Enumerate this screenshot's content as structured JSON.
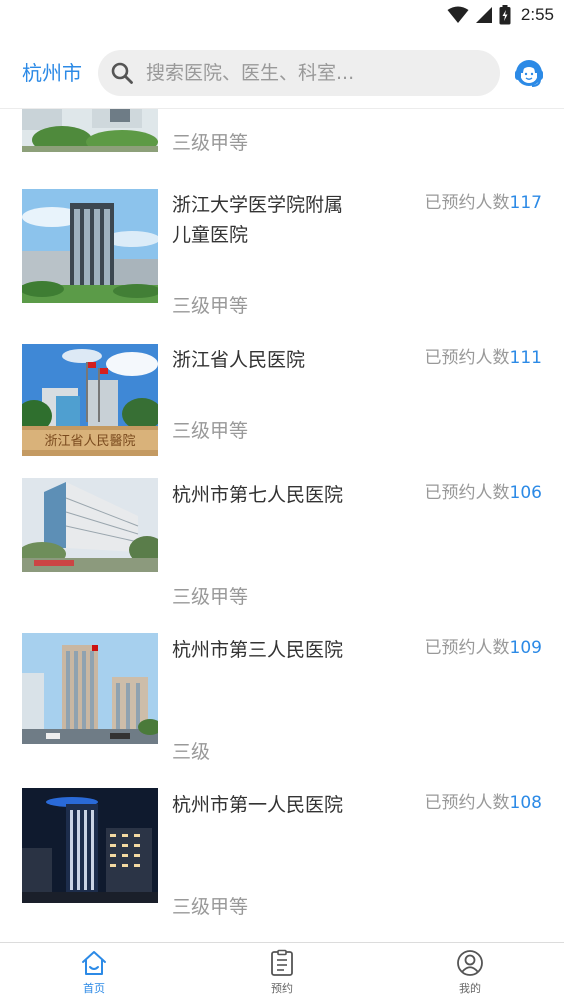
{
  "status_bar": {
    "time": "2:55"
  },
  "header": {
    "city": "杭州市",
    "search_placeholder": "搜索医院、医生、科室..."
  },
  "hospitals": [
    {
      "name": "",
      "grade": "三级甲等",
      "appt_label": "",
      "appt_count": ""
    },
    {
      "name": "浙江大学医学院附属儿童医院",
      "grade": "三级甲等",
      "appt_label": "已预约人数",
      "appt_count": "117"
    },
    {
      "name": "浙江省人民医院",
      "grade": "三级甲等",
      "appt_label": "已预约人数",
      "appt_count": "111"
    },
    {
      "name": "杭州市第七人民医院",
      "grade": "三级甲等",
      "appt_label": "已预约人数",
      "appt_count": "106"
    },
    {
      "name": "杭州市第三人民医院",
      "grade": "三级",
      "appt_label": "已预约人数",
      "appt_count": "109"
    },
    {
      "name": "杭州市第一人民医院",
      "grade": "三级甲等",
      "appt_label": "已预约人数",
      "appt_count": "108"
    }
  ],
  "bottom_nav": {
    "items": [
      {
        "label": "首页",
        "active": true
      },
      {
        "label": "预约",
        "active": false
      },
      {
        "label": "我的",
        "active": false
      }
    ]
  },
  "colors": {
    "accent": "#2c8ae6",
    "muted": "#999999"
  }
}
